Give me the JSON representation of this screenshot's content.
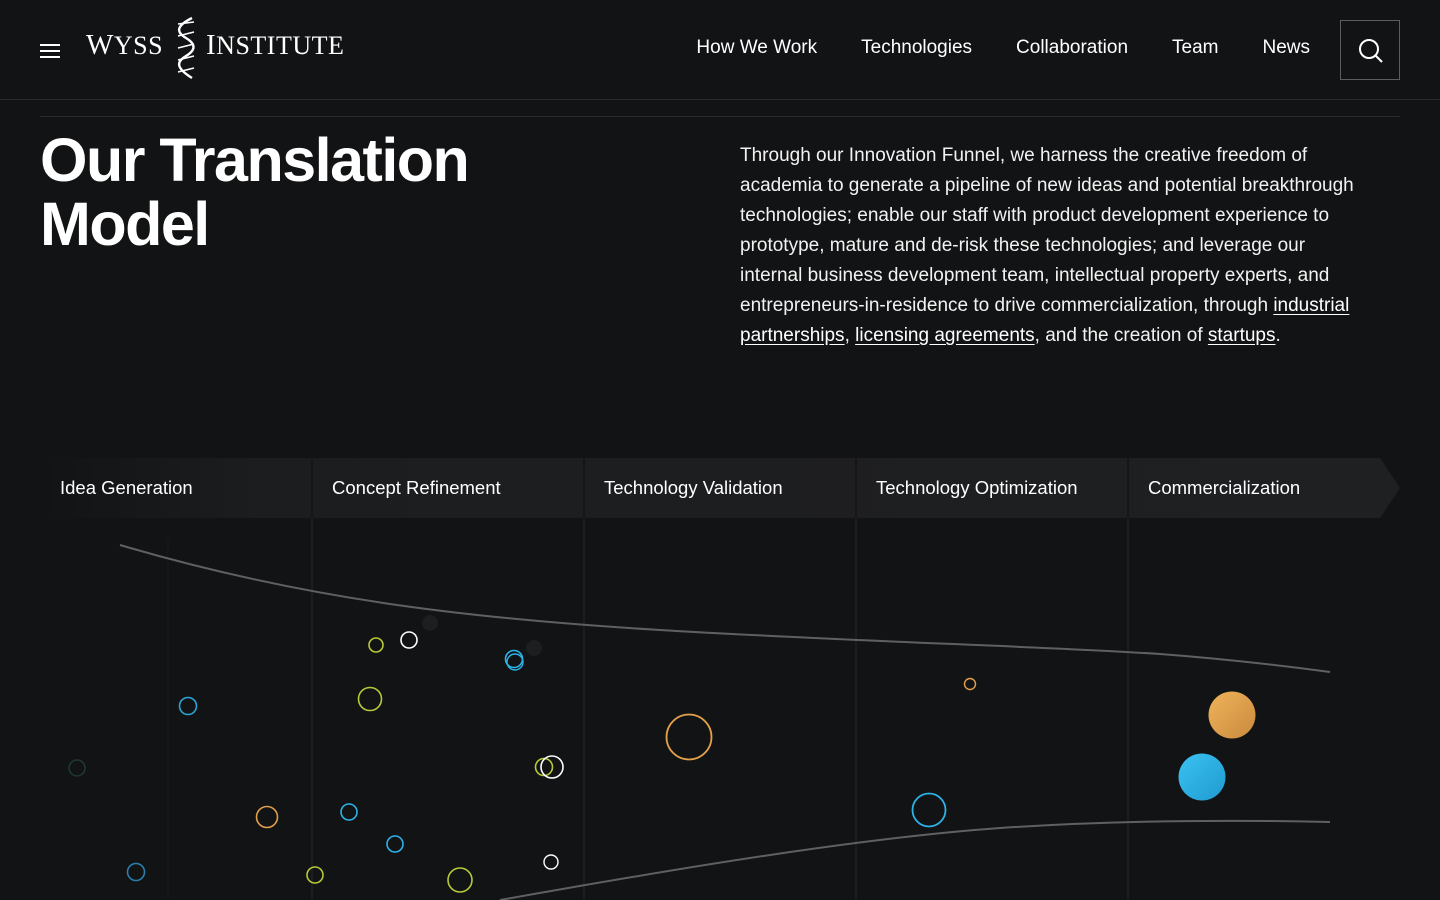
{
  "brand": {
    "name": "WYSS INSTITUTE",
    "word1_cap": "W",
    "word1_rest": "YSS",
    "word2_cap": "I",
    "word2_rest": "NSTITUTE"
  },
  "nav": {
    "items": [
      {
        "label": "How We Work"
      },
      {
        "label": "Technologies"
      },
      {
        "label": "Collaboration"
      },
      {
        "label": "Team"
      },
      {
        "label": "News"
      }
    ]
  },
  "icons": {
    "menu": "hamburger-icon",
    "search": "search-icon",
    "logo": "dna-helix-icon"
  },
  "hero": {
    "title_line1": "Our Translation",
    "title_line2": "Model",
    "intro_text": "Through our Innovation Funnel, we harness the creative freedom of academia to generate a pipeline of new ideas and potential breakthrough technologies; enable our staff with product development experience to prototype, mature and de-risk these technologies; and leverage our internal business development team, intellectual property experts, and entrepreneurs-in-residence to drive commercialization, through ",
    "link_partnerships": "industrial partnerships",
    "sep1": ", ",
    "link_licensing": "licensing agreements",
    "sep2": ", and the creation of ",
    "link_startups": "startups",
    "end": "."
  },
  "stages": [
    {
      "label": "Idea Generation"
    },
    {
      "label": "Concept Refinement"
    },
    {
      "label": "Technology Validation"
    },
    {
      "label": "Technology Optimization"
    },
    {
      "label": "Commercialization"
    }
  ],
  "colors": {
    "background": "#121314",
    "blue": "#2db3e8",
    "orange": "#e3a04a",
    "green": "#b8c93a",
    "white": "#ffffff",
    "stage_band": "#1c1d1f"
  }
}
